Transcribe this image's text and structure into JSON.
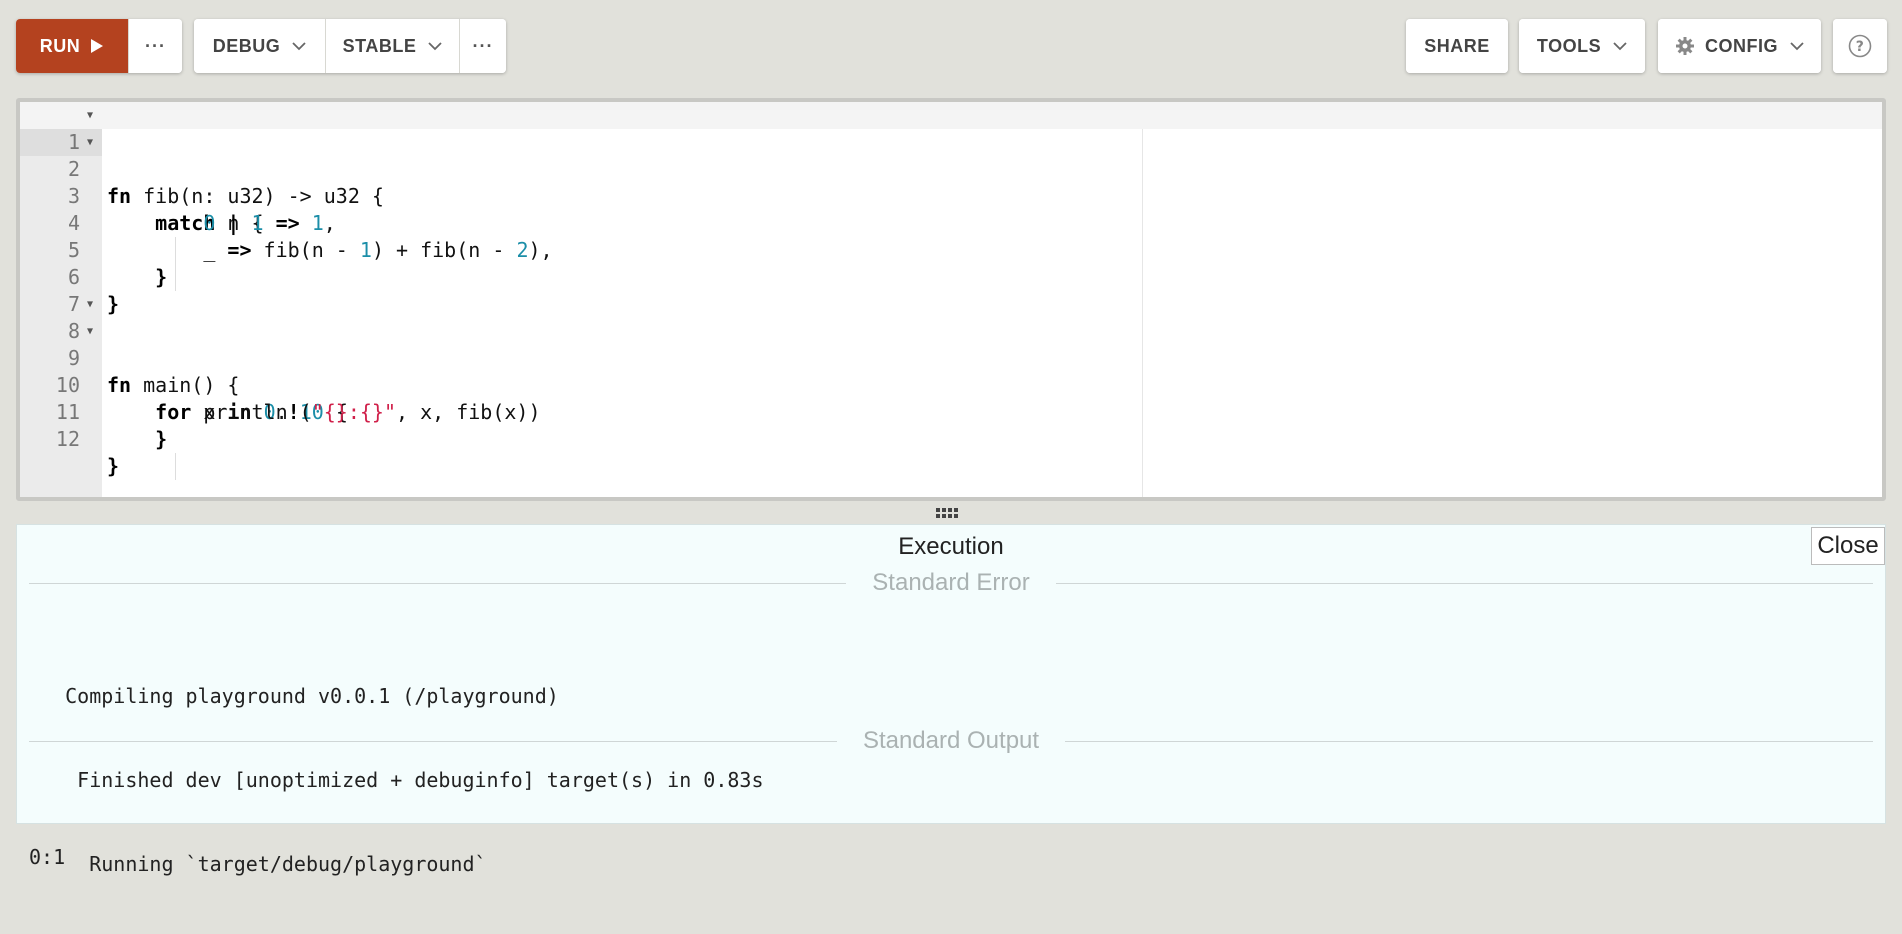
{
  "toolbar": {
    "run_label": "RUN",
    "more_label": "···",
    "mode_label": "DEBUG",
    "channel_label": "STABLE",
    "more2_label": "···",
    "share_label": "SHARE",
    "tools_label": "TOOLS",
    "config_label": "CONFIG",
    "help_label": "?"
  },
  "colors": {
    "run_button": "#b4421f",
    "background": "#e1e1db",
    "number": "#1b8ea8",
    "string": "#d0204a",
    "output_bg": "#f4fdfd"
  },
  "editor": {
    "line_numbers": [
      "1",
      "2",
      "3",
      "4",
      "5",
      "6",
      "7",
      "8",
      "9",
      "10",
      "11",
      "12"
    ],
    "active_line": 1,
    "foldable_lines": [
      1,
      2,
      8,
      9
    ]
  },
  "output": {
    "title": "Execution",
    "close_label": "Close",
    "stderr_label": "Standard Error",
    "stderr_lines": [
      "   Compiling playground v0.0.1 (/playground)",
      "    Finished dev [unoptimized + debuginfo] target(s) in 0.83s",
      "     Running `target/debug/playground`"
    ],
    "stdout_label": "Standard Output",
    "stdout_lines": [
      "0:1"
    ]
  }
}
